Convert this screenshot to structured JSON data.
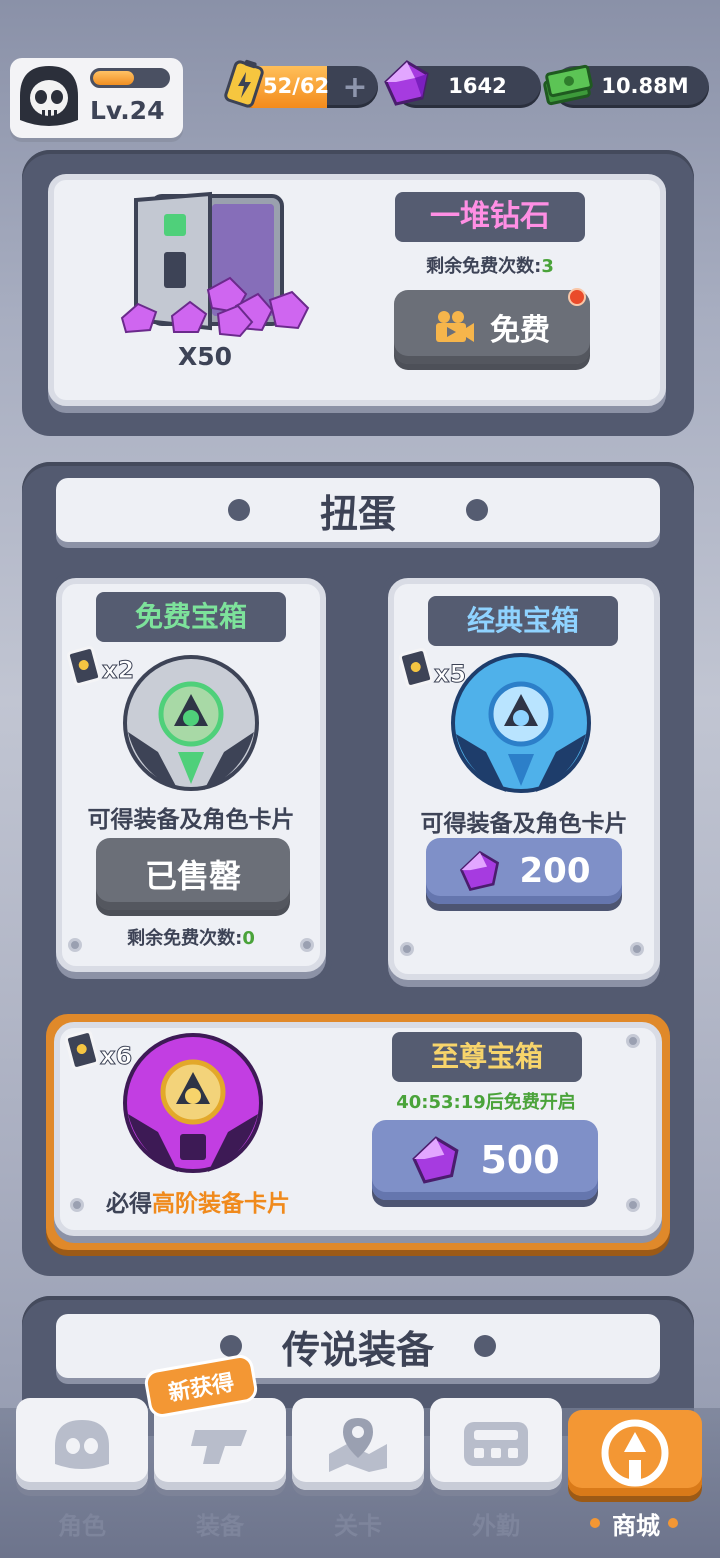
{
  "top_bar": {
    "level": "Lv.24",
    "xp_progress": 0.55,
    "energy": "52/62",
    "energy_plus": "+",
    "gems": "1642",
    "cash": "10.88M"
  },
  "diamond_offer": {
    "title": "一堆钻石",
    "quantity": "X50",
    "remaining_label": "剩余免费次数:",
    "remaining_count": "3",
    "button_label": "免费"
  },
  "gacha": {
    "title": "扭蛋",
    "free_chest": {
      "title": "免费宝箱",
      "multiplier": "x2",
      "description": "可得装备及角色卡片",
      "button_label": "已售罄",
      "remaining_label": "剩余免费次数:",
      "remaining_count": "0"
    },
    "classic_chest": {
      "title": "经典宝箱",
      "multiplier": "x5",
      "description": "可得装备及角色卡片",
      "price": "200"
    },
    "supreme_chest": {
      "title": "至尊宝箱",
      "multiplier": "x6",
      "timer": "40:53:19后免费开启",
      "description_prefix": "必得",
      "description_highlight": "高阶装备卡片",
      "price": "500"
    }
  },
  "legend_section": {
    "title": "传说装备"
  },
  "nav": {
    "badge": "新获得",
    "tabs": [
      "角色",
      "装备",
      "关卡",
      "外勤",
      "商城"
    ]
  },
  "colors": {
    "accent_orange": "#f39734",
    "title_green": "#7de29b",
    "title_blue": "#8fd3ff",
    "title_yellow": "#f7d46b",
    "title_pink": "#ff8fe4",
    "highlight_orange": "#f08a1c",
    "timer_green": "#4aa33a"
  }
}
